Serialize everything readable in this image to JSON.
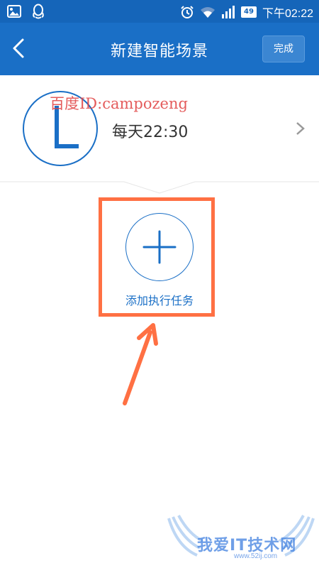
{
  "status_bar": {
    "battery": "49",
    "time": "下午02:22",
    "icons": [
      "gallery-icon",
      "qq-icon",
      "alarm-icon",
      "wifi-icon",
      "signal-icon",
      "battery-icon"
    ]
  },
  "header": {
    "title": "新建智能场景",
    "done_label": "完成"
  },
  "trigger": {
    "time_label": "每天22:30"
  },
  "watermark": {
    "text": "百度ID:campozeng"
  },
  "add_task": {
    "label": "添加执行任务"
  },
  "logo_watermark": {
    "text": "我爱IT技术网",
    "url": "www.52ij.com"
  },
  "colors": {
    "primary": "#1a6fc6",
    "status_bar": "#1565b9",
    "highlight": "#ff7043",
    "watermark_red": "#e04040"
  }
}
